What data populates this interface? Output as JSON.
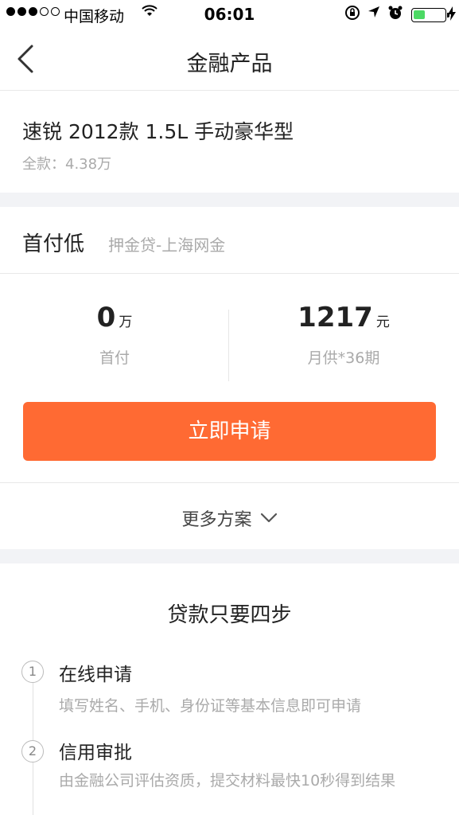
{
  "status_bar": {
    "carrier": "中国移动",
    "time": "06:01"
  },
  "nav": {
    "title": "金融产品"
  },
  "product": {
    "name": "速锐 2012款 1.5L 手动豪华型",
    "price": "全款：4.38万"
  },
  "plan": {
    "title": "首付低",
    "subtitle": "押金贷-上海网金",
    "down_payment": {
      "value": "0",
      "unit": "万",
      "label": "首付"
    },
    "monthly": {
      "value": "1217",
      "unit": "元",
      "label": "月供*36期"
    },
    "apply_label": "立即申请",
    "more_label": "更多方案"
  },
  "steps": {
    "title": "贷款只要四步",
    "items": [
      {
        "index": "1",
        "title": "在线申请",
        "desc": "填写姓名、手机、身份证等基本信息即可申请"
      },
      {
        "index": "2",
        "title": "信用审批",
        "desc": "由金融公司评估资质，提交材料最快10秒得到结果"
      }
    ]
  },
  "colors": {
    "accent": "#ff6a33",
    "battery": "#4cd964",
    "section_gap": "#f2f3f6"
  }
}
